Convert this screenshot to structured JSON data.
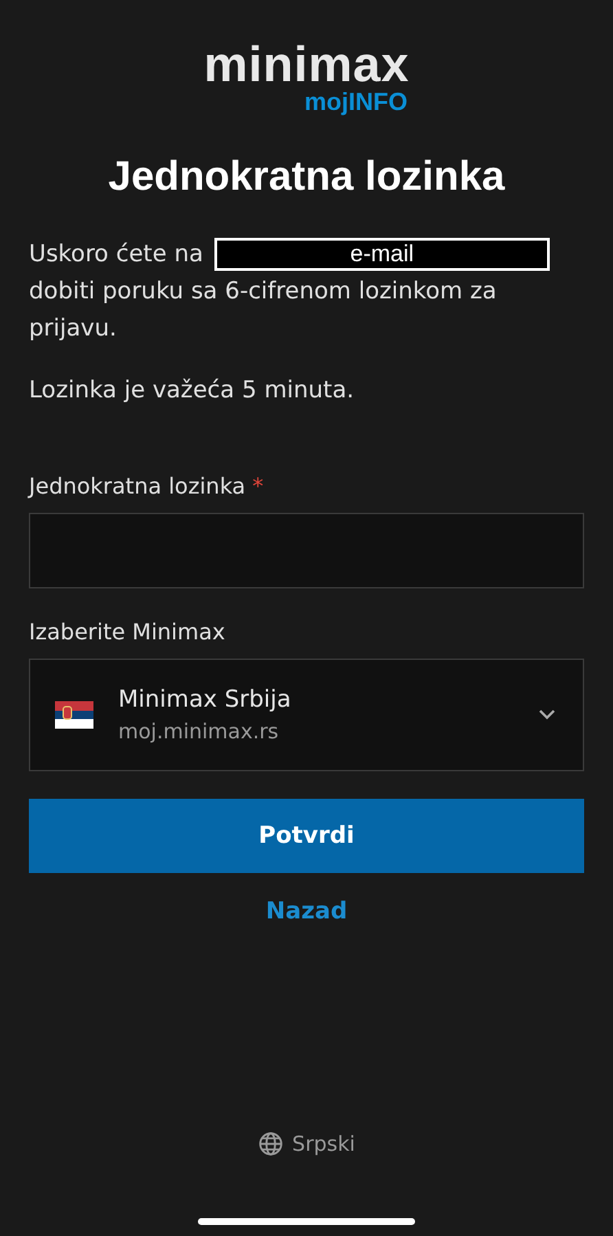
{
  "logo": {
    "brand": "minimax",
    "product": "mojINFO"
  },
  "title": "Jednokratna lozinka",
  "message": {
    "before": "Uskoro ćete na",
    "redacted": "e-mail",
    "after": "dobiti poruku sa 6-cifrenom lozinkom za prijavu."
  },
  "validity": "Lozinka je važeća 5 minuta.",
  "otp_field": {
    "label": "Jednokratna lozinka",
    "required_mark": "*"
  },
  "select": {
    "label": "Izaberite Minimax",
    "option": {
      "name": "Minimax Srbija",
      "url": "moj.minimax.rs"
    }
  },
  "buttons": {
    "confirm": "Potvrdi",
    "back": "Nazad"
  },
  "language": "Srpski"
}
